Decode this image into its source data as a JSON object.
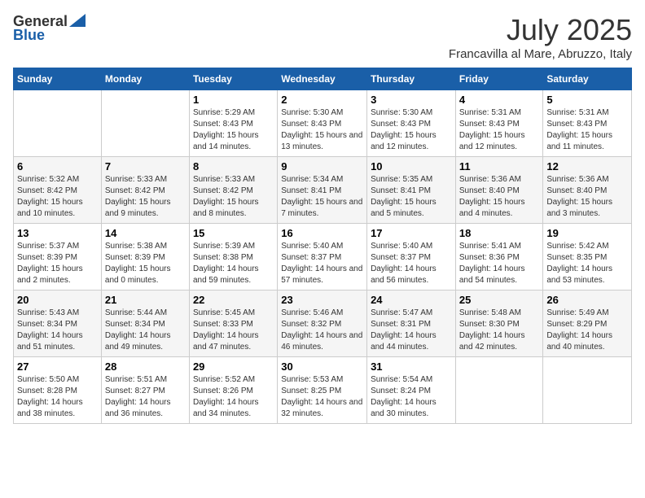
{
  "logo": {
    "general": "General",
    "blue": "Blue"
  },
  "title": "July 2025",
  "location": "Francavilla al Mare, Abruzzo, Italy",
  "headers": [
    "Sunday",
    "Monday",
    "Tuesday",
    "Wednesday",
    "Thursday",
    "Friday",
    "Saturday"
  ],
  "weeks": [
    [
      {
        "day": "",
        "sunrise": "",
        "sunset": "",
        "daylight": ""
      },
      {
        "day": "",
        "sunrise": "",
        "sunset": "",
        "daylight": ""
      },
      {
        "day": "1",
        "sunrise": "Sunrise: 5:29 AM",
        "sunset": "Sunset: 8:43 PM",
        "daylight": "Daylight: 15 hours and 14 minutes."
      },
      {
        "day": "2",
        "sunrise": "Sunrise: 5:30 AM",
        "sunset": "Sunset: 8:43 PM",
        "daylight": "Daylight: 15 hours and 13 minutes."
      },
      {
        "day": "3",
        "sunrise": "Sunrise: 5:30 AM",
        "sunset": "Sunset: 8:43 PM",
        "daylight": "Daylight: 15 hours and 12 minutes."
      },
      {
        "day": "4",
        "sunrise": "Sunrise: 5:31 AM",
        "sunset": "Sunset: 8:43 PM",
        "daylight": "Daylight: 15 hours and 12 minutes."
      },
      {
        "day": "5",
        "sunrise": "Sunrise: 5:31 AM",
        "sunset": "Sunset: 8:43 PM",
        "daylight": "Daylight: 15 hours and 11 minutes."
      }
    ],
    [
      {
        "day": "6",
        "sunrise": "Sunrise: 5:32 AM",
        "sunset": "Sunset: 8:42 PM",
        "daylight": "Daylight: 15 hours and 10 minutes."
      },
      {
        "day": "7",
        "sunrise": "Sunrise: 5:33 AM",
        "sunset": "Sunset: 8:42 PM",
        "daylight": "Daylight: 15 hours and 9 minutes."
      },
      {
        "day": "8",
        "sunrise": "Sunrise: 5:33 AM",
        "sunset": "Sunset: 8:42 PM",
        "daylight": "Daylight: 15 hours and 8 minutes."
      },
      {
        "day": "9",
        "sunrise": "Sunrise: 5:34 AM",
        "sunset": "Sunset: 8:41 PM",
        "daylight": "Daylight: 15 hours and 7 minutes."
      },
      {
        "day": "10",
        "sunrise": "Sunrise: 5:35 AM",
        "sunset": "Sunset: 8:41 PM",
        "daylight": "Daylight: 15 hours and 5 minutes."
      },
      {
        "day": "11",
        "sunrise": "Sunrise: 5:36 AM",
        "sunset": "Sunset: 8:40 PM",
        "daylight": "Daylight: 15 hours and 4 minutes."
      },
      {
        "day": "12",
        "sunrise": "Sunrise: 5:36 AM",
        "sunset": "Sunset: 8:40 PM",
        "daylight": "Daylight: 15 hours and 3 minutes."
      }
    ],
    [
      {
        "day": "13",
        "sunrise": "Sunrise: 5:37 AM",
        "sunset": "Sunset: 8:39 PM",
        "daylight": "Daylight: 15 hours and 2 minutes."
      },
      {
        "day": "14",
        "sunrise": "Sunrise: 5:38 AM",
        "sunset": "Sunset: 8:39 PM",
        "daylight": "Daylight: 15 hours and 0 minutes."
      },
      {
        "day": "15",
        "sunrise": "Sunrise: 5:39 AM",
        "sunset": "Sunset: 8:38 PM",
        "daylight": "Daylight: 14 hours and 59 minutes."
      },
      {
        "day": "16",
        "sunrise": "Sunrise: 5:40 AM",
        "sunset": "Sunset: 8:37 PM",
        "daylight": "Daylight: 14 hours and 57 minutes."
      },
      {
        "day": "17",
        "sunrise": "Sunrise: 5:40 AM",
        "sunset": "Sunset: 8:37 PM",
        "daylight": "Daylight: 14 hours and 56 minutes."
      },
      {
        "day": "18",
        "sunrise": "Sunrise: 5:41 AM",
        "sunset": "Sunset: 8:36 PM",
        "daylight": "Daylight: 14 hours and 54 minutes."
      },
      {
        "day": "19",
        "sunrise": "Sunrise: 5:42 AM",
        "sunset": "Sunset: 8:35 PM",
        "daylight": "Daylight: 14 hours and 53 minutes."
      }
    ],
    [
      {
        "day": "20",
        "sunrise": "Sunrise: 5:43 AM",
        "sunset": "Sunset: 8:34 PM",
        "daylight": "Daylight: 14 hours and 51 minutes."
      },
      {
        "day": "21",
        "sunrise": "Sunrise: 5:44 AM",
        "sunset": "Sunset: 8:34 PM",
        "daylight": "Daylight: 14 hours and 49 minutes."
      },
      {
        "day": "22",
        "sunrise": "Sunrise: 5:45 AM",
        "sunset": "Sunset: 8:33 PM",
        "daylight": "Daylight: 14 hours and 47 minutes."
      },
      {
        "day": "23",
        "sunrise": "Sunrise: 5:46 AM",
        "sunset": "Sunset: 8:32 PM",
        "daylight": "Daylight: 14 hours and 46 minutes."
      },
      {
        "day": "24",
        "sunrise": "Sunrise: 5:47 AM",
        "sunset": "Sunset: 8:31 PM",
        "daylight": "Daylight: 14 hours and 44 minutes."
      },
      {
        "day": "25",
        "sunrise": "Sunrise: 5:48 AM",
        "sunset": "Sunset: 8:30 PM",
        "daylight": "Daylight: 14 hours and 42 minutes."
      },
      {
        "day": "26",
        "sunrise": "Sunrise: 5:49 AM",
        "sunset": "Sunset: 8:29 PM",
        "daylight": "Daylight: 14 hours and 40 minutes."
      }
    ],
    [
      {
        "day": "27",
        "sunrise": "Sunrise: 5:50 AM",
        "sunset": "Sunset: 8:28 PM",
        "daylight": "Daylight: 14 hours and 38 minutes."
      },
      {
        "day": "28",
        "sunrise": "Sunrise: 5:51 AM",
        "sunset": "Sunset: 8:27 PM",
        "daylight": "Daylight: 14 hours and 36 minutes."
      },
      {
        "day": "29",
        "sunrise": "Sunrise: 5:52 AM",
        "sunset": "Sunset: 8:26 PM",
        "daylight": "Daylight: 14 hours and 34 minutes."
      },
      {
        "day": "30",
        "sunrise": "Sunrise: 5:53 AM",
        "sunset": "Sunset: 8:25 PM",
        "daylight": "Daylight: 14 hours and 32 minutes."
      },
      {
        "day": "31",
        "sunrise": "Sunrise: 5:54 AM",
        "sunset": "Sunset: 8:24 PM",
        "daylight": "Daylight: 14 hours and 30 minutes."
      },
      {
        "day": "",
        "sunrise": "",
        "sunset": "",
        "daylight": ""
      },
      {
        "day": "",
        "sunrise": "",
        "sunset": "",
        "daylight": ""
      }
    ]
  ]
}
